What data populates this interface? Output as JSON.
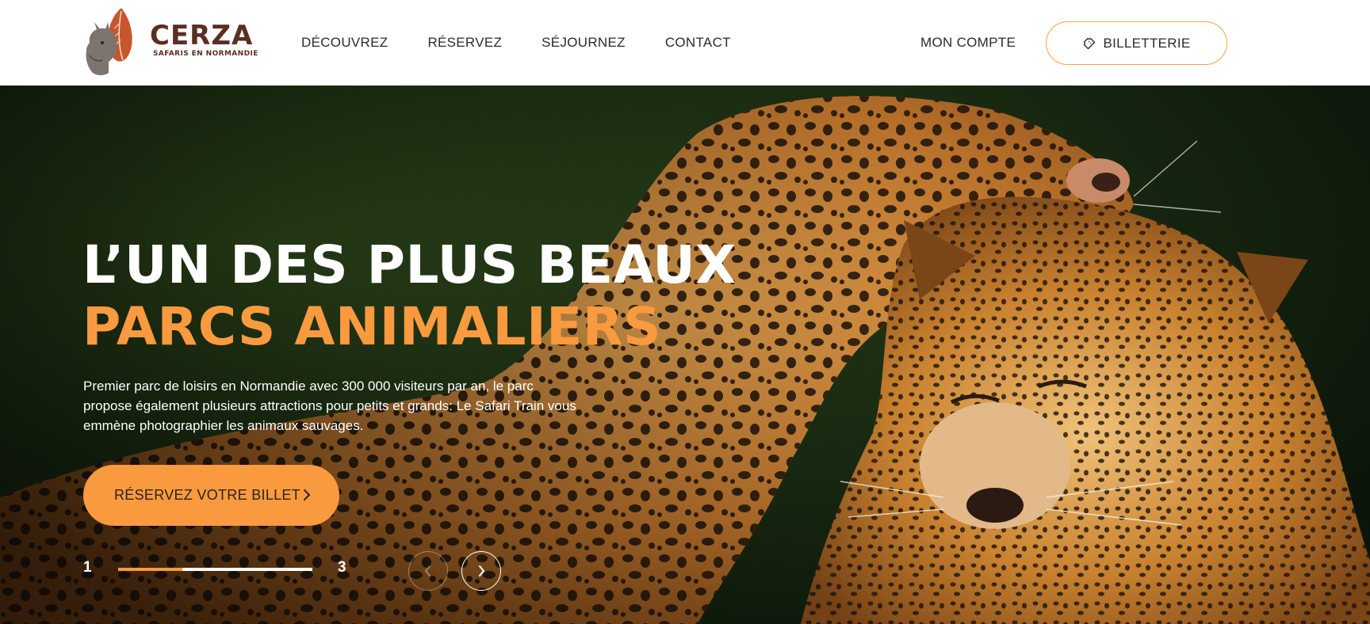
{
  "brand": {
    "name": "CERZA",
    "tagline": "SAFARIS EN NORMANDIE",
    "colors": {
      "primary": "#5a2e22",
      "accent": "#f99a3f",
      "outline": "#f6a24a"
    }
  },
  "nav": {
    "items": [
      {
        "label": "DÉCOUVREZ"
      },
      {
        "label": "RÉSERVEZ"
      },
      {
        "label": "SÉJOURNEZ"
      },
      {
        "label": "CONTACT"
      }
    ],
    "account_label": "MON COMPTE",
    "tickets_label": "BILLETTERIE",
    "tickets_icon": "ticket-icon"
  },
  "hero": {
    "title_line1": "L’UN DES PLUS BEAUX",
    "title_line2": "PARCS ANIMALIERS",
    "description": "Premier parc de loisirs en Normandie avec 300 000 visiteurs par an, le parc propose également plusieurs attractions pour petits et grands: Le Safari Train vous emmène photographier les animaux sauvages.",
    "cta_label": "RÉSERVEZ VOTRE BILLET",
    "cta_icon": "chevron-right-icon",
    "image_subject": "two leopards"
  },
  "slider": {
    "current": "1",
    "total": "3",
    "progress_fraction": 0.33,
    "prev_icon": "chevron-left-icon",
    "next_icon": "chevron-right-icon"
  }
}
